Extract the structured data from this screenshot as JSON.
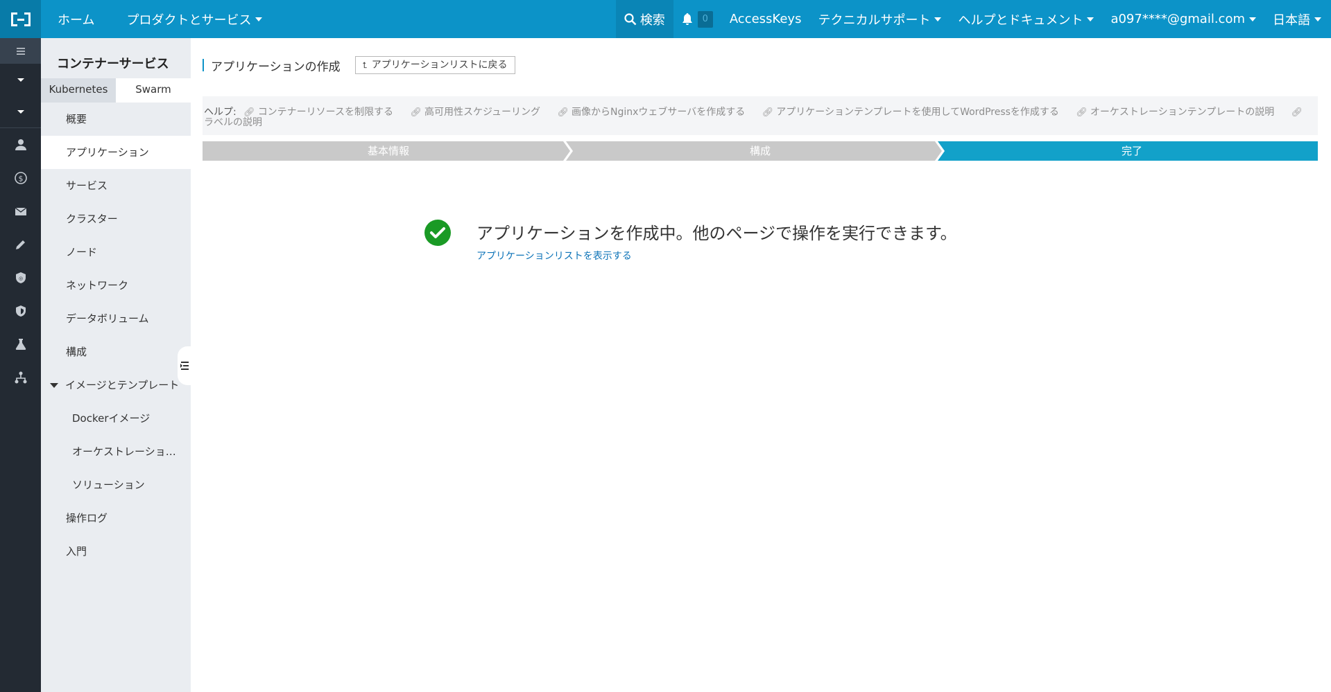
{
  "topbar": {
    "home": "ホーム",
    "products": "プロダクトとサービス",
    "search": "検索",
    "notification_count": "0",
    "access_keys": "AccessKeys",
    "support": "テクニカルサポート",
    "docs": "ヘルプとドキュメント",
    "account": "a097****@gmail.com",
    "language": "日本語"
  },
  "sidebar": {
    "title": "コンテナーサービス",
    "tabs": [
      "Kubernetes",
      "Swarm"
    ],
    "items": [
      "概要",
      "アプリケーション",
      "サービス",
      "クラスター",
      "ノード",
      "ネットワーク",
      "データボリューム",
      "構成"
    ],
    "group": "イメージとテンプレート",
    "sub_items": [
      "Dockerイメージ",
      "オーケストレーショ…",
      "ソリューション"
    ],
    "bottom_items": [
      "操作ログ",
      "入門"
    ]
  },
  "main": {
    "title": "アプリケーションの作成",
    "back_button": "アプリケーションリストに戻る",
    "help_label": "ヘルプ:",
    "help_links": [
      "コンテナーリソースを制限する",
      "高可用性スケジューリング",
      "画像からNginxウェブサーバを作成する",
      "アプリケーションテンプレートを使用してWordPressを作成する",
      "オーケストレーションテンプレートの説明",
      "ラベルの説明"
    ],
    "steps": [
      "基本情報",
      "構成",
      "完了"
    ],
    "success_message": "アプリケーションを作成中。他のページで操作を実行できます。",
    "success_link": "アプリケーションリストを表示する"
  },
  "colors": {
    "brand": "#0c93c8",
    "step_inactive": "#c9c9c9",
    "step_active": "#12a1c9",
    "success": "#1a9a25"
  }
}
